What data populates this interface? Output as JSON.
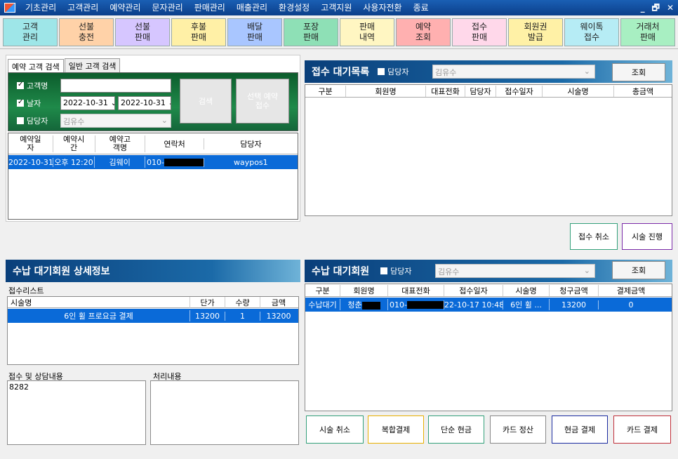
{
  "menu": [
    "기초관리",
    "고객관리",
    "예약관리",
    "문자관리",
    "판매관리",
    "매출관리",
    "환경설정",
    "고객지원",
    "사용자전환",
    "종료"
  ],
  "window_controls": [
    "_",
    "🗗",
    "✕"
  ],
  "toolbar": [
    {
      "l1": "고객",
      "l2": "관리",
      "color": "#9ee6e8"
    },
    {
      "l1": "선불",
      "l2": "충전",
      "color": "#ffd2a8"
    },
    {
      "l1": "선불",
      "l2": "판매",
      "color": "#d6c6ff"
    },
    {
      "l1": "후불",
      "l2": "판매",
      "color": "#fff0a6"
    },
    {
      "l1": "배달",
      "l2": "판매",
      "color": "#a9c6ff"
    },
    {
      "l1": "포장",
      "l2": "판매",
      "color": "#8ee0b6"
    },
    {
      "l1": "판매",
      "l2": "내역",
      "color": "#fff6c2"
    },
    {
      "l1": "예약",
      "l2": "조회",
      "color": "#ffb0b0"
    },
    {
      "l1": "접수",
      "l2": "판매",
      "color": "#ffd8ea"
    },
    {
      "l1": "회원권",
      "l2": "발급",
      "color": "#fff1a6"
    },
    {
      "l1": "웨이톡",
      "l2": "접수",
      "color": "#b6ecf5"
    },
    {
      "l1": "거래처",
      "l2": "판매",
      "color": "#a8efc2"
    }
  ],
  "search": {
    "tabs": [
      "예약 고객 검색",
      "일반 고객 검색"
    ],
    "name_label": "고객명",
    "date_label": "날자",
    "date_from": "2022-10-31",
    "date_to": "2022-10-31",
    "staff_label": "담당자",
    "staff_value": "김유수",
    "search_btn": "검색",
    "select_btn": "선택 예약 접수",
    "headers": [
      "예약일자",
      "예약시간",
      "예약고객명",
      "연락처",
      "담당자"
    ],
    "rows": [
      [
        "2022-10-31",
        "오후 12:20",
        "김웨이",
        "010-",
        "waypos1"
      ]
    ]
  },
  "queue": {
    "title": "접수 대기목록",
    "staff_label": "담당자",
    "staff_value": "김유수",
    "query_btn": "조회",
    "headers": [
      "구분",
      "회원명",
      "대표전화",
      "담당자",
      "접수일자",
      "시술명",
      "총금액"
    ],
    "cancel_btn": "접수 취소",
    "proceed_btn": "시술 진행"
  },
  "detail": {
    "title": "수납 대기회원 상세정보",
    "list_label": "접수리스트",
    "headers": [
      "시술명",
      "단가",
      "수량",
      "금액"
    ],
    "rows": [
      [
        "6인 휠 프로요금 결제",
        "13200",
        "1",
        "13200"
      ]
    ],
    "consult_label": "접수 및 상담내용",
    "consult_text": "8282",
    "process_label": "처리내용"
  },
  "payment": {
    "title": "수납 대기회원",
    "staff_label": "담당자",
    "staff_value": "김유수",
    "query_btn": "조회",
    "headers": [
      "구분",
      "회원명",
      "대표전화",
      "접수일자",
      "시술명",
      "청구금액",
      "결제금액"
    ],
    "rows": [
      [
        "수납대기",
        "청춘",
        "010-",
        "22-10-17 10:48",
        "6인 휠 ...",
        "13200",
        "0"
      ]
    ]
  },
  "bottom_buttons": [
    {
      "label": "시술 취소",
      "color": "#33a07a"
    },
    {
      "label": "복합결제",
      "color": "#e8b000"
    },
    {
      "label": "단순 현금",
      "color": "#33a07a"
    },
    {
      "label": "카드 정산",
      "color": "#888888"
    },
    {
      "label": "현금 결제",
      "color": "#1a2aa0"
    },
    {
      "label": "카드 결제",
      "color": "#c0303a"
    }
  ]
}
